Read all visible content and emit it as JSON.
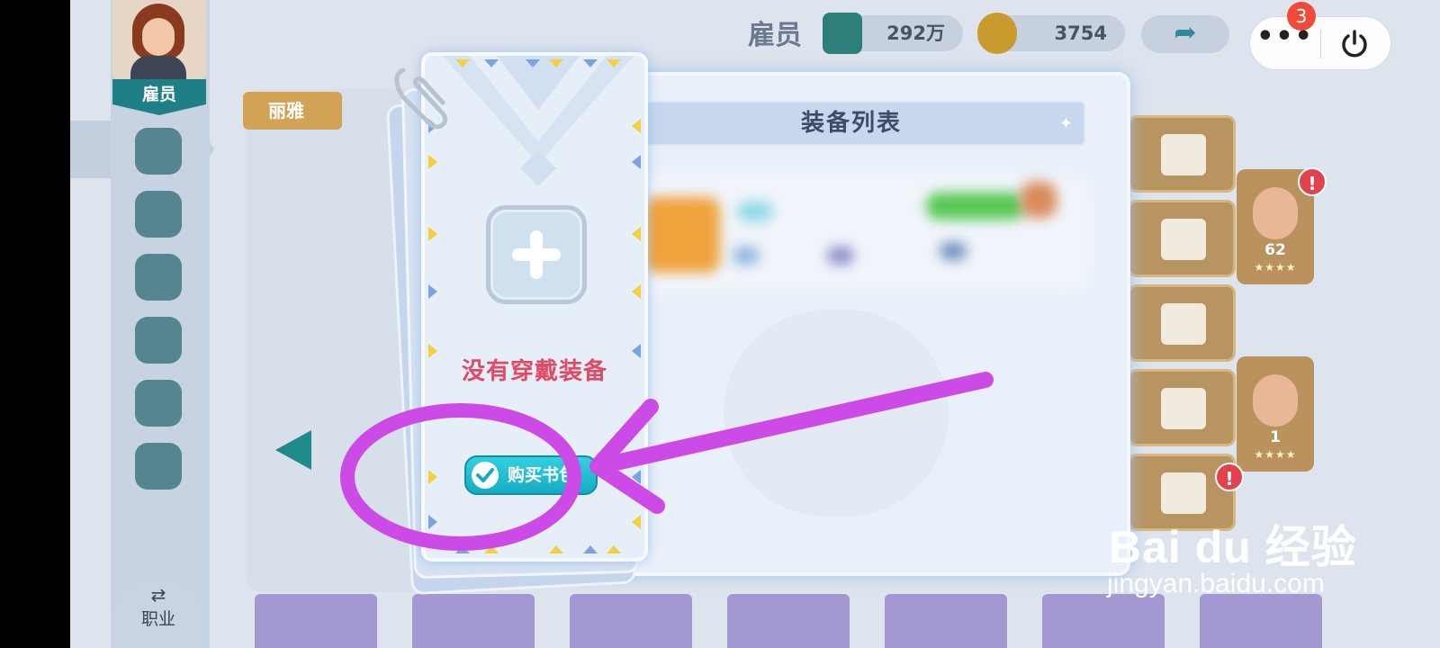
{
  "screen": {
    "role_tab_label": "雇员",
    "job_button_label": "职业",
    "swap_symbol": "⇄",
    "page_title": "雇员",
    "currencies": [
      {
        "name": "exp",
        "value": "292万",
        "icon": "exp-book-icon"
      },
      {
        "name": "coins",
        "value": "3754",
        "icon": "coin-icon"
      }
    ],
    "back_arrow": "➦",
    "name_tag": "丽雅",
    "hero_levels": [
      "62",
      "1"
    ],
    "stars": "★★★★",
    "alert_mark": "!"
  },
  "system": {
    "notification_count": "3",
    "more_label": "•••"
  },
  "modal": {
    "title": "装备列表",
    "sparkle": "✦"
  },
  "equip_card": {
    "empty_text": "没有穿戴装备",
    "buy_button_label": "购买书包"
  },
  "watermark": {
    "brand": "Bai du 经验",
    "url": "jingyan.baidu.com"
  },
  "colors": {
    "accent_teal": "#1e7f86",
    "empty_text": "#e04a64",
    "buy_button": "#17aac4",
    "annotation_purple": "#cc4be6",
    "badge_red": "#f04a3b"
  }
}
